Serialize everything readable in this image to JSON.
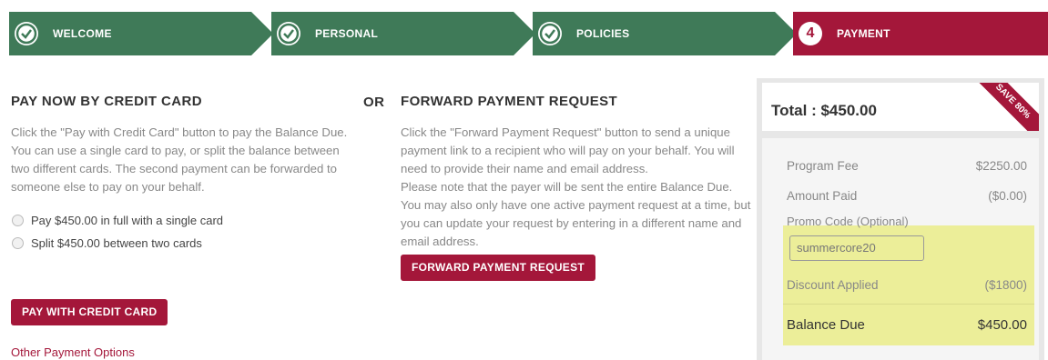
{
  "stepper": {
    "steps": [
      {
        "label": "WELCOME",
        "state": "complete",
        "color": "#3f7a58"
      },
      {
        "label": "PERSONAL",
        "state": "complete",
        "color": "#3f7a58"
      },
      {
        "label": "POLICIES",
        "state": "complete",
        "color": "#3f7a58"
      },
      {
        "label": "PAYMENT",
        "number": "4",
        "state": "current",
        "color": "#a4173a"
      }
    ]
  },
  "pay_now": {
    "title": "PAY NOW BY CREDIT CARD",
    "description": "Click the \"Pay with Credit Card\" button to pay the Balance Due. You can use a single card to pay, or split the balance between two different cards. The second payment can be forwarded to someone else to pay on your behalf.",
    "options": [
      {
        "label": "Pay $450.00 in full with a single card",
        "selected": false
      },
      {
        "label": "Split $450.00 between two cards",
        "selected": false
      }
    ],
    "button_label": "PAY WITH CREDIT CARD",
    "other_link": "Other Payment Options"
  },
  "or_label": "OR",
  "forward": {
    "title": "FORWARD PAYMENT REQUEST",
    "description1": "Click the \"Forward Payment Request\" button to send a unique payment link to a recipient who will pay on your behalf. You will need to provide their name and email address.",
    "description2": "Please note that the payer will be sent the entire Balance Due. You may also only have one active payment request at a time, but you can update your request by entering in a different name and email address.",
    "button_label": "FORWARD PAYMENT REQUEST"
  },
  "summary": {
    "total": "Total : $450.00",
    "ribbon": "SAVE 80%",
    "program_fee_label": "Program Fee",
    "program_fee_value": "$2250.00",
    "amount_paid_label": "Amount Paid",
    "amount_paid_value": "($0.00)",
    "promo_label": "Promo Code (Optional)",
    "promo_value": "summercore20",
    "discount_label": "Discount Applied",
    "discount_value": "($1800)",
    "balance_label": "Balance Due",
    "balance_value": "$450.00"
  },
  "colors": {
    "green": "#3f7a58",
    "crimson": "#a4173a",
    "highlight": "#ecee99"
  }
}
